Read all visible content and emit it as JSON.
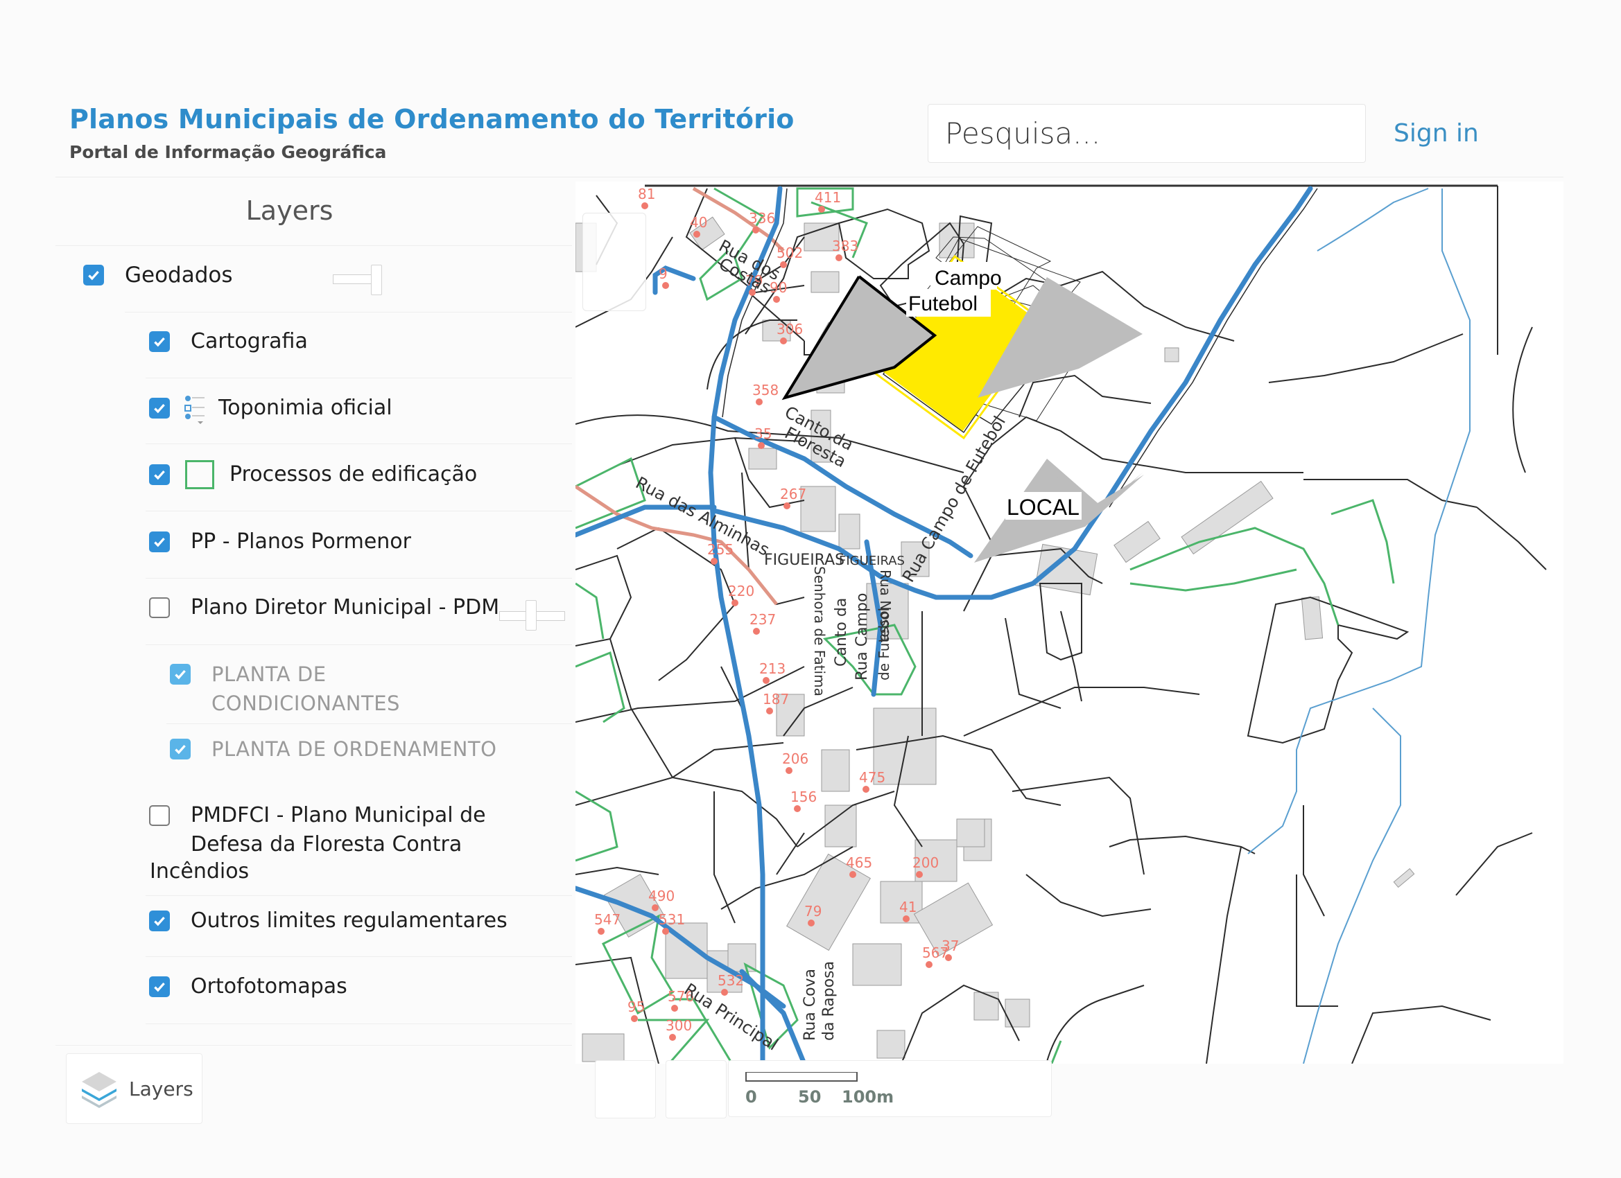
{
  "header": {
    "title": "Planos Municipais de Ordenamento do Território",
    "subtitle": "Portal de Informação Geográfica",
    "search_placeholder": "Pesquisa...",
    "sign_in": "Sign in"
  },
  "layers_panel": {
    "title": "Layers",
    "items": [
      {
        "label": "Geodados",
        "checked": true,
        "level": 0,
        "opacity": 1.0
      },
      {
        "label": "Cartografia",
        "checked": true,
        "level": 1
      },
      {
        "label": "Toponimia oficial",
        "checked": true,
        "level": 1,
        "legend_icon": "legend-list-icon"
      },
      {
        "label": "Processos de edificação",
        "checked": true,
        "level": 1,
        "legend_icon": "green-square-legend-icon"
      },
      {
        "label": "PP - Planos Pormenor",
        "checked": true,
        "level": 1
      },
      {
        "label": "Plano Diretor Municipal - PDM",
        "checked": false,
        "level": 1,
        "opacity": 0.5
      },
      {
        "label": "PLANTA DE CONDICIONANTES",
        "checked": true,
        "level": 2,
        "disabled": true
      },
      {
        "label": "PLANTA DE ORDENAMENTO",
        "checked": true,
        "level": 2,
        "disabled": true
      },
      {
        "label": "PMDFCI - Plano Municipal de Defesa da Floresta Contra Incêndios",
        "checked": false,
        "level": 1
      },
      {
        "label": "Outros limites regulamentares",
        "checked": true,
        "level": 1
      },
      {
        "label": "Ortofotomapas",
        "checked": true,
        "level": 1
      }
    ],
    "pmdfci_lines": [
      "PMDFCI - Plano Municipal de",
      "Defesa da Floresta Contra",
      "Incêndios"
    ],
    "planta_cond_lines": [
      "PLANTA DE",
      "CONDICIONANTES"
    ],
    "toggle_button": "Layers"
  },
  "map": {
    "street_labels": {
      "rua_dos_costas_1": "Rua dos",
      "rua_dos_costas_2": "Costas",
      "canto_floresta_1": "Canto.da",
      "canto_floresta_2": "Floresta",
      "rua_alminhas": "Rua das Alminhas",
      "figueiras_1": "FIGUEIRAS",
      "figueiras_2": "FIGUEIRAS",
      "rua_campo_futebol": "Rua Campo de Futebol",
      "senhora_fatima": "Senhora de Fatima",
      "rua_nossa": "Rua Nossa",
      "canto_da": "Canto da",
      "rua_campo": "Rua Campo",
      "de_futebol": "de Futebol",
      "rua_principal": "Rua Principal",
      "rua_cova": "Rua Cova",
      "da_raposa": "da Raposa"
    },
    "annotations": {
      "campo_1": "Campo",
      "campo_2": "Futebol",
      "local": "LOCAL"
    },
    "house_numbers": [
      "81",
      "40",
      "336",
      "79",
      "502",
      "9",
      "90",
      "411",
      "383",
      "306",
      "358",
      "35",
      "267",
      "255",
      "220",
      "237",
      "213",
      "187",
      "206",
      "156",
      "475",
      "465",
      "490",
      "531",
      "547",
      "532",
      "576",
      "300",
      "95",
      "79",
      "41",
      "200",
      "567",
      "37"
    ],
    "colors": {
      "road": "#3a86c8",
      "parcel": "#2b2b2b",
      "process": "#4bb56a",
      "pp_road": "#e09585",
      "building": "#dcdcdc",
      "number": "#f07a6e",
      "stream": "#5a9fd0",
      "campo": "#ffe800",
      "local": "#bdbdbd"
    },
    "scale": {
      "labels": [
        "0",
        "50",
        "100m"
      ]
    }
  }
}
